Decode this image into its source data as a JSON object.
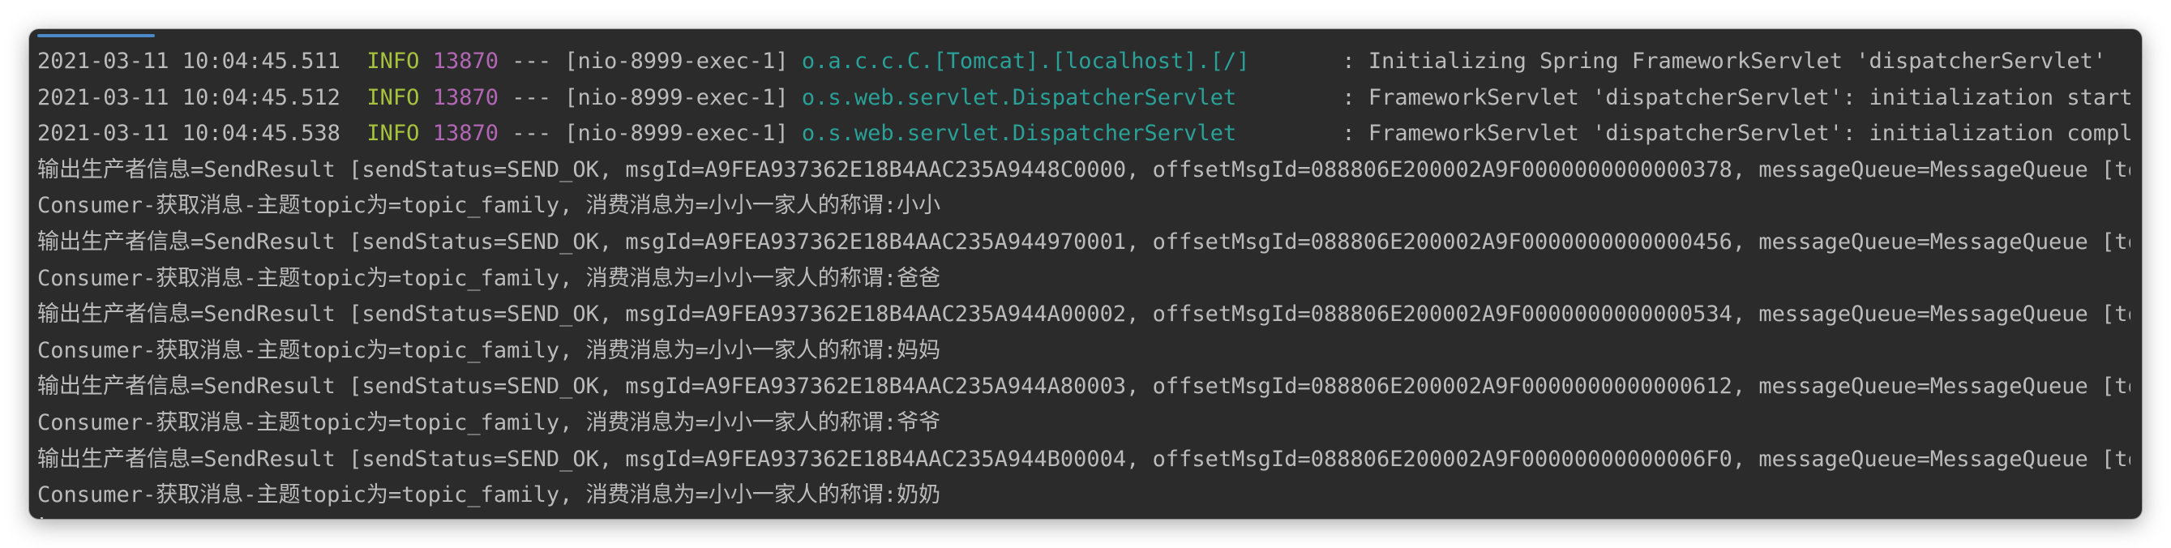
{
  "log_lines": [
    {
      "timestamp": "2021-03-11 10:04:45.511",
      "level": "INFO",
      "pid": "13870",
      "thread": " --- [nio-8999-exec-1] ",
      "logger": "o.a.c.c.C.[Tomcat].[localhost].[/]      ",
      "message": " : Initializing Spring FrameworkServlet 'dispatcherServlet'"
    },
    {
      "timestamp": "2021-03-11 10:04:45.512",
      "level": "INFO",
      "pid": "13870",
      "thread": " --- [nio-8999-exec-1] ",
      "logger": "o.s.web.servlet.DispatcherServlet       ",
      "message": " : FrameworkServlet 'dispatcherServlet': initialization started"
    },
    {
      "timestamp": "2021-03-11 10:04:45.538",
      "level": "INFO",
      "pid": "13870",
      "thread": " --- [nio-8999-exec-1] ",
      "logger": "o.s.web.servlet.DispatcherServlet       ",
      "message": " : FrameworkServlet 'dispatcherServlet': initialization completed"
    }
  ],
  "output_lines": [
    "输出生产者信息=SendResult [sendStatus=SEND_OK, msgId=A9FEA937362E18B4AAC235A9448C0000, offsetMsgId=088806E200002A9F0000000000000378, messageQueue=MessageQueue [topic=topic_family",
    "Consumer-获取消息-主题topic为=topic_family, 消费消息为=小小一家人的称谓:小小",
    "输出生产者信息=SendResult [sendStatus=SEND_OK, msgId=A9FEA937362E18B4AAC235A944970001, offsetMsgId=088806E200002A9F0000000000000456, messageQueue=MessageQueue [topic=topic_family",
    "Consumer-获取消息-主题topic为=topic_family, 消费消息为=小小一家人的称谓:爸爸",
    "输出生产者信息=SendResult [sendStatus=SEND_OK, msgId=A9FEA937362E18B4AAC235A944A00002, offsetMsgId=088806E200002A9F0000000000000534, messageQueue=MessageQueue [topic=topic_family",
    "Consumer-获取消息-主题topic为=topic_family, 消费消息为=小小一家人的称谓:妈妈",
    "输出生产者信息=SendResult [sendStatus=SEND_OK, msgId=A9FEA937362E18B4AAC235A944A80003, offsetMsgId=088806E200002A9F0000000000000612, messageQueue=MessageQueue [topic=topic_family",
    "Consumer-获取消息-主题topic为=topic_family, 消费消息为=小小一家人的称谓:爷爷",
    "输出生产者信息=SendResult [sendStatus=SEND_OK, msgId=A9FEA937362E18B4AAC235A944B00004, offsetMsgId=088806E200002A9F00000000000006F0, messageQueue=MessageQueue [topic=topic_family",
    "Consumer-获取消息-主题topic为=topic_family, 消费消息为=小小一家人的称谓:奶奶"
  ],
  "colors": {
    "background": "#2b2b2b",
    "text": "#bbbbbb",
    "level_info": "#a6c23d",
    "pid": "#b267b5",
    "logger": "#2aa198",
    "active_tab_indicator": "#4a88c7"
  }
}
